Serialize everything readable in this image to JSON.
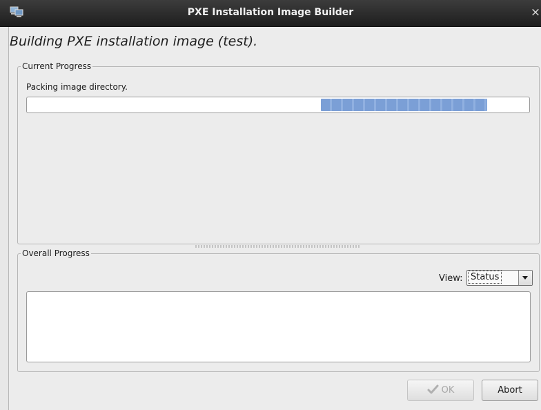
{
  "window": {
    "title": "PXE Installation Image Builder",
    "icon": "computer-network-icon",
    "close_icon": "close-icon",
    "close_glyph": "×"
  },
  "heading": "Building PXE installation image (test).",
  "current_progress": {
    "label": "Current Progress",
    "status_text": "Packing image directory.",
    "progress": {
      "mode": "indeterminate-pulse",
      "color": "#7b9fd6"
    }
  },
  "overall_progress": {
    "label": "Overall Progress",
    "view_label": "View:",
    "view_selected": "Status",
    "log_text": ""
  },
  "buttons": {
    "ok_label": "OK",
    "ok_enabled": false,
    "ok_icon": "check-icon",
    "abort_label": "Abort"
  },
  "colors": {
    "titlebar": "#2a2a2a",
    "window_bg": "#ececec",
    "progress_fill": "#7b9fd6"
  }
}
